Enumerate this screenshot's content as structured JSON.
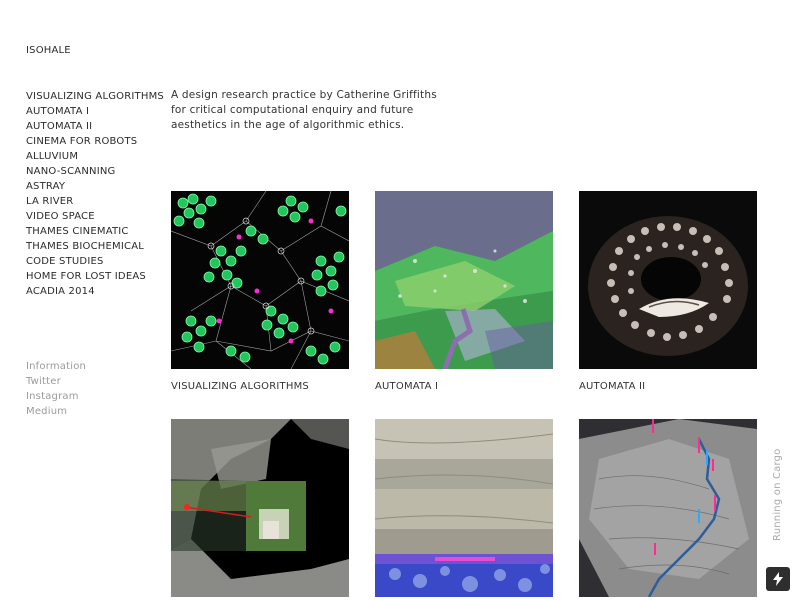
{
  "site": {
    "title": "ISOHALE"
  },
  "nav": {
    "items": [
      "VISUALIZING ALGORITHMS",
      "AUTOMATA I",
      "AUTOMATA II",
      "CINEMA FOR ROBOTS",
      "ALLUVIUM",
      "NANO-SCANNING",
      "ASTRAY",
      "LA RIVER",
      "VIDEO SPACE",
      "THAMES CINEMATIC",
      "THAMES BIOCHEMICAL",
      "CODE STUDIES",
      "HOME FOR LOST IDEAS",
      "ACADIA 2014"
    ],
    "secondary": [
      "Information",
      "Twitter",
      "Instagram",
      "Medium"
    ]
  },
  "intro": {
    "line1": "A design research practice by Catherine Griffiths",
    "line2": "for critical computational enquiry and future",
    "line3": "aesthetics in the age of algorithmic ethics."
  },
  "projects": [
    {
      "caption": "VISUALIZING ALGORITHMS",
      "image": "green-network-graph"
    },
    {
      "caption": "AUTOMATA I",
      "image": "aerial-landscape"
    },
    {
      "caption": "AUTOMATA II",
      "image": "spiral-texture"
    },
    {
      "caption": "",
      "image": "cave-scan"
    },
    {
      "caption": "",
      "image": "sediment-layers"
    },
    {
      "caption": "",
      "image": "terrain-model"
    }
  ],
  "footer": {
    "cargo_badge": "Running on Cargo",
    "bolt_icon": "lightning-bolt-icon"
  },
  "colors": {
    "text": "#2b2b2b",
    "secondary_text": "#9b9b9b",
    "accent_green": "#2ee86a",
    "accent_magenta": "#ff2bd6"
  }
}
